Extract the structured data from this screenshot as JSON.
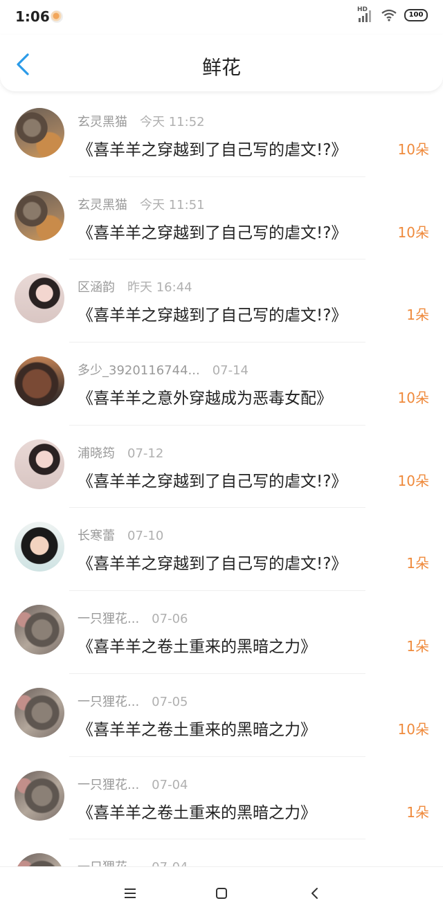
{
  "status_bar": {
    "time": "1:06",
    "network": "HD",
    "battery": "100"
  },
  "header": {
    "title": "鲜花",
    "back_icon": "chevron-left-icon"
  },
  "accent_color": "#2b9be8",
  "amount_color": "#ef8a3c",
  "items": [
    {
      "user": "玄灵黑猫",
      "time": "今天 11:52",
      "title": "《喜羊羊之穿越到了自己写的虐文!?》",
      "amount": "10朵",
      "avatar": "cat-photo"
    },
    {
      "user": "玄灵黑猫",
      "time": "今天 11:51",
      "title": "《喜羊羊之穿越到了自己写的虐文!?》",
      "amount": "10朵",
      "avatar": "cat-photo"
    },
    {
      "user": "区涵韵",
      "time": "昨天 16:44",
      "title": "《喜羊羊之穿越到了自己写的虐文!?》",
      "amount": "1朵",
      "avatar": "girl-photo"
    },
    {
      "user": "多少_3920116744...",
      "time": "07-14",
      "title": "《喜羊羊之意外穿越成为恶毒女配》",
      "amount": "10朵",
      "avatar": "rock-photo"
    },
    {
      "user": "浦晓筠",
      "time": "07-12",
      "title": "《喜羊羊之穿越到了自己写的虐文!?》",
      "amount": "10朵",
      "avatar": "girl-photo"
    },
    {
      "user": "长寒蕾",
      "time": "07-10",
      "title": "《喜羊羊之穿越到了自己写的虐文!?》",
      "amount": "1朵",
      "avatar": "child-photo"
    },
    {
      "user": "一只狸花...",
      "time": "07-06",
      "title": "《喜羊羊之卷土重来的黑暗之力》",
      "amount": "1朵",
      "avatar": "tabby-cat-photo"
    },
    {
      "user": "一只狸花...",
      "time": "07-05",
      "title": "《喜羊羊之卷土重来的黑暗之力》",
      "amount": "10朵",
      "avatar": "tabby-cat-photo"
    },
    {
      "user": "一只狸花...",
      "time": "07-04",
      "title": "《喜羊羊之卷土重来的黑暗之力》",
      "amount": "1朵",
      "avatar": "tabby-cat-photo"
    },
    {
      "user": "一只狸花...",
      "time": "07-04",
      "title": "",
      "amount": "",
      "avatar": "tabby-cat-photo"
    }
  ],
  "nav_bar": {
    "menu_icon": "menu-icon",
    "home_icon": "home-square-icon",
    "back_icon": "back-triangle-icon"
  }
}
